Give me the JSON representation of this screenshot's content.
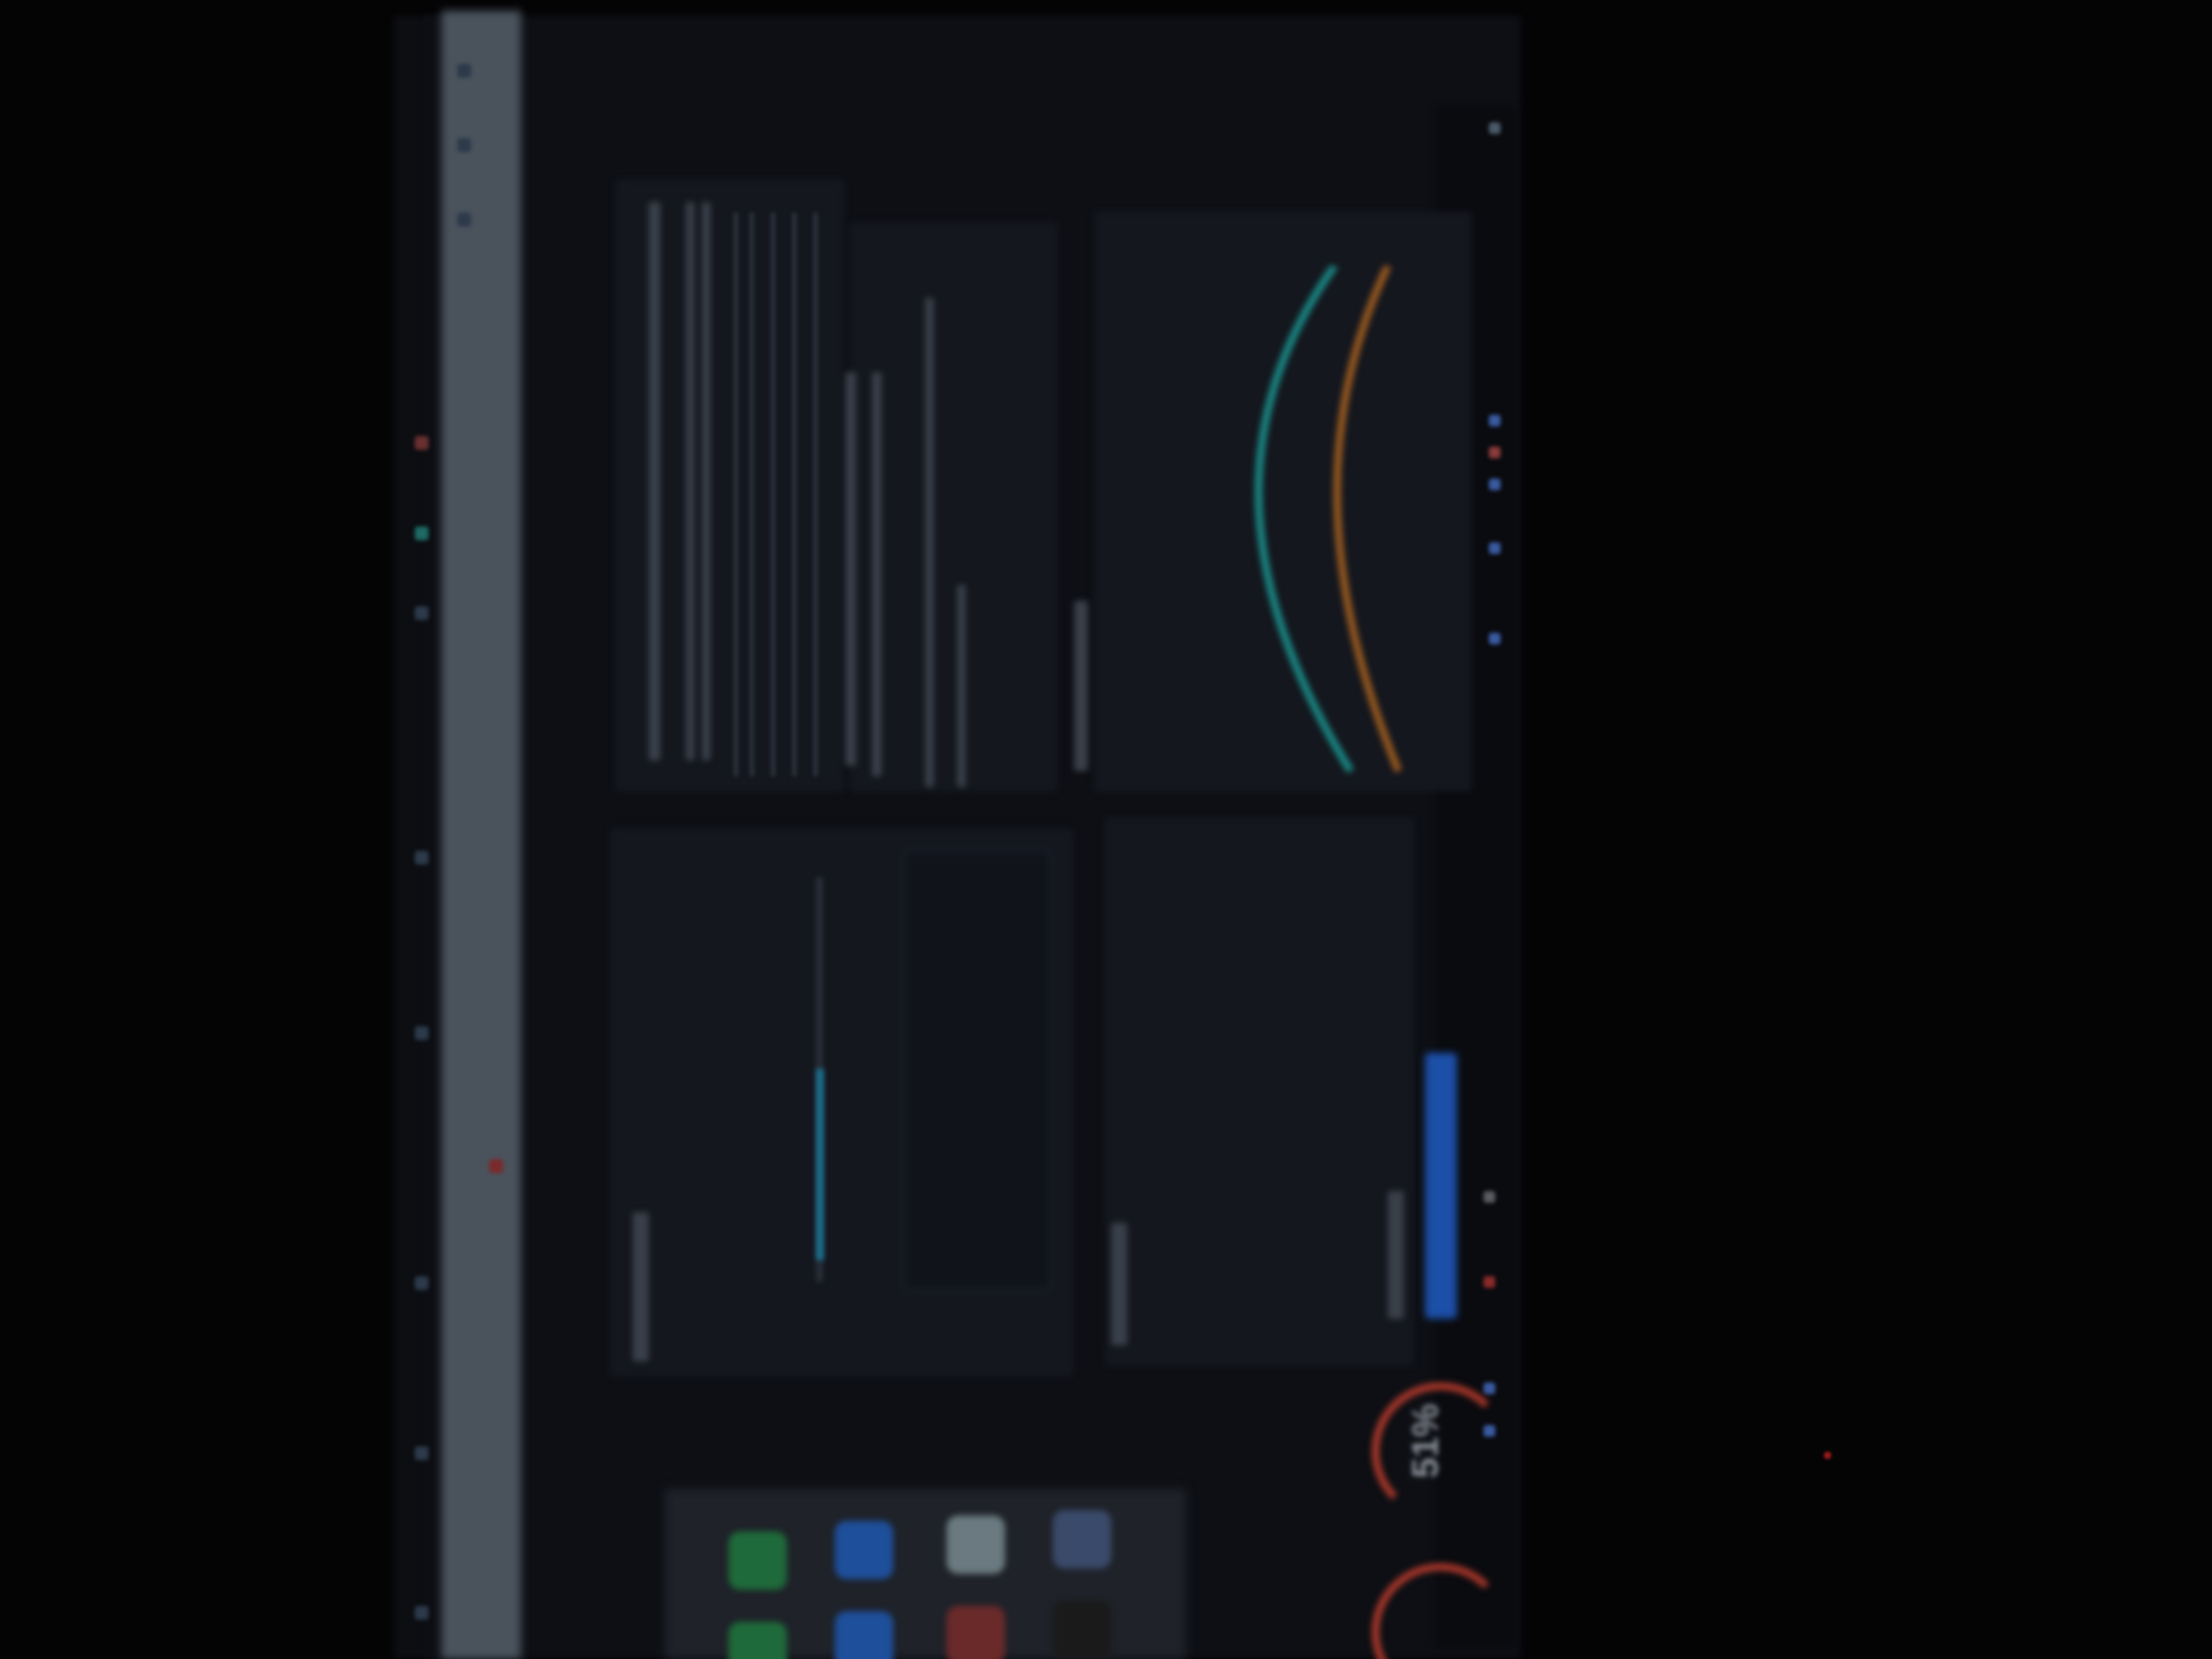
{
  "gauges": [
    {
      "value_text": "51%"
    }
  ],
  "colors": {
    "accent_blue": "#1c4fa8",
    "teal_curve": "#1a8a86",
    "orange_curve": "#9a5a20",
    "gauge_red": "#a8372a",
    "slider_teal": "#19708f"
  },
  "icons": {
    "app_icon_1": "phone-icon",
    "app_icon_2": "calendar-icon",
    "app_icon_3": "photos-icon",
    "app_icon_4": "browser-icon"
  }
}
